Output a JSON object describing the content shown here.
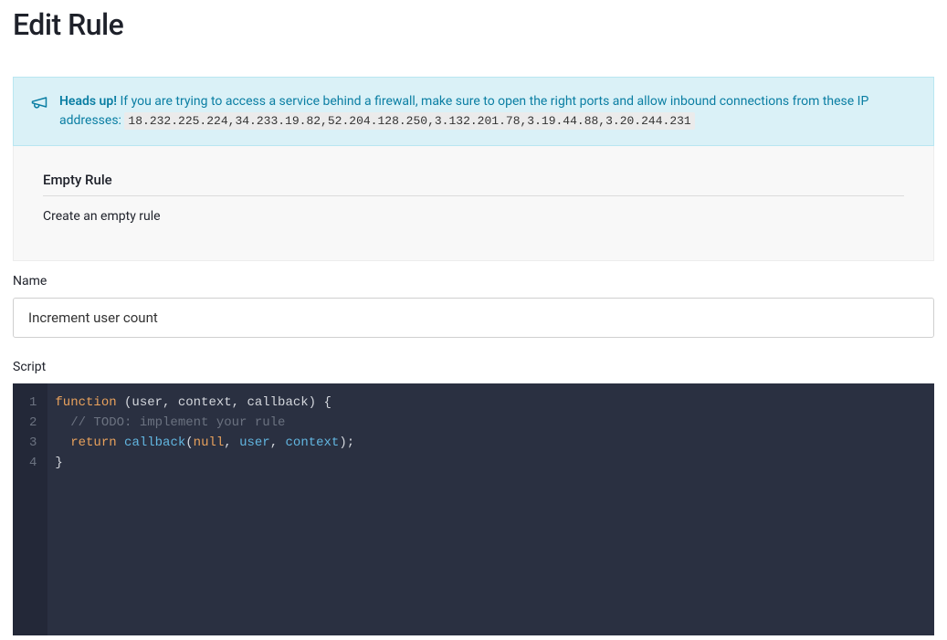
{
  "header": {
    "title": "Edit Rule"
  },
  "alert": {
    "strong": "Heads up!",
    "message": " If you are trying to access a service behind a firewall, make sure to open the right ports and allow inbound connections from these IP addresses: ",
    "ips": "18.232.225.224,34.233.19.82,52.204.128.250,3.132.201.78,3.19.44.88,3.20.244.231"
  },
  "info": {
    "heading": "Empty Rule",
    "description": "Create an empty rule"
  },
  "form": {
    "name_label": "Name",
    "name_value": "Increment user count",
    "script_label": "Script"
  },
  "editor": {
    "line_numbers": [
      "1",
      "2",
      "3",
      "4"
    ],
    "line1": {
      "kw": "function",
      "rest": " (user, context, callback) {"
    },
    "line2": {
      "indent": "  ",
      "comment": "// TODO: implement your rule"
    },
    "line3": {
      "indent": "  ",
      "kw": "return",
      "sp": " ",
      "fn": "callback",
      "open": "(",
      "null": "null",
      "c1": ", ",
      "p1": "user",
      "c2": ", ",
      "p2": "context",
      "close": ");"
    },
    "line4": {
      "brace": "}"
    }
  }
}
